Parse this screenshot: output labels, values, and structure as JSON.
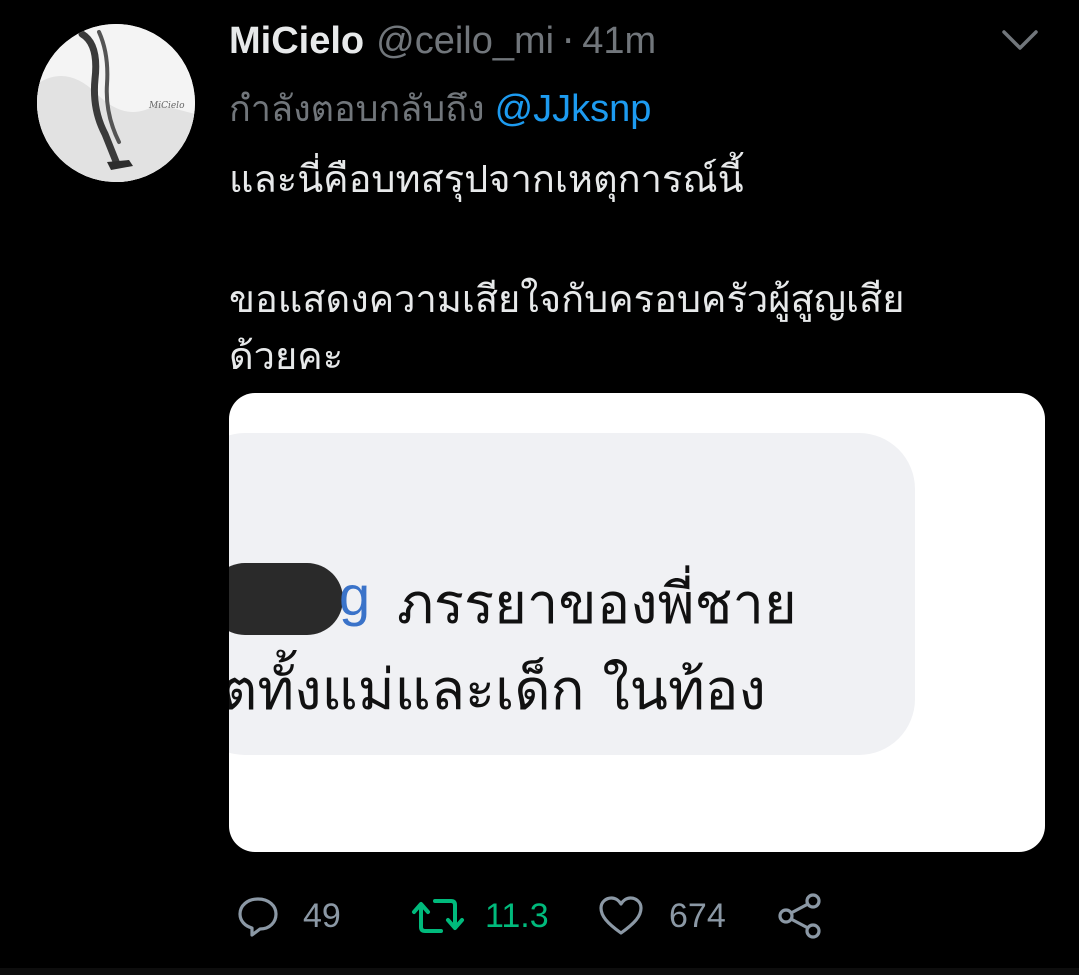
{
  "tweet": {
    "display_name": "MiCielo",
    "handle": "@ceilo_mi",
    "separator": "·",
    "time": "41m",
    "replying_prefix": "กำลังตอบกลับถึง",
    "replying_to": "@JJksnp",
    "body_line1": "และนี่คือบทสรุปจากเหตุการณ์นี้",
    "body_line2": "ขอแสดงความเสียใจกับครอบครัวผู้สูญเสีย",
    "body_line3": "ด้วยคะ",
    "avatar_signature": "MiCielo"
  },
  "media": {
    "partial_letter": "g",
    "line1": "ภรรยาของพี่ชาย",
    "line2": "ตทั้งแม่และเด็ก ในท้อง"
  },
  "actions": {
    "reply_count": "49",
    "retweet_count": "11.3",
    "like_count": "674"
  },
  "colors": {
    "background": "#000000",
    "text": "#e7e9ea",
    "muted": "#71767b",
    "link": "#1d9bf0",
    "retweet": "#00ba7c"
  },
  "icons": {
    "more": "chevron-down-icon",
    "reply": "reply-icon",
    "retweet": "retweet-icon",
    "like": "heart-icon",
    "share": "share-icon"
  }
}
